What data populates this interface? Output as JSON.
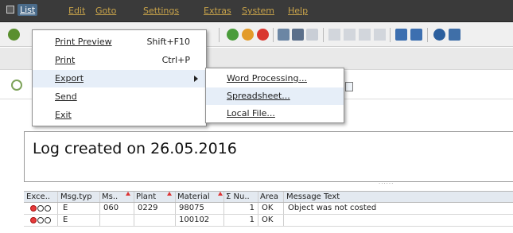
{
  "menubar": {
    "items": [
      {
        "label": "List"
      },
      {
        "label": "Edit"
      },
      {
        "label": "Goto"
      },
      {
        "label": "Settings"
      },
      {
        "label": "Extras"
      },
      {
        "label": "System"
      },
      {
        "label": "Help"
      }
    ]
  },
  "list_menu": {
    "items": [
      {
        "label": "Print Preview",
        "shortcut": "Shift+F10"
      },
      {
        "label": "Print",
        "shortcut": "Ctrl+P"
      },
      {
        "label": "Export",
        "shortcut": ""
      },
      {
        "label": "Send",
        "shortcut": ""
      },
      {
        "label": "Exit",
        "shortcut": ""
      }
    ]
  },
  "export_menu": {
    "items": [
      {
        "label": "Word Processing..."
      },
      {
        "label": "Spreadsheet..."
      },
      {
        "label": "Local File..."
      }
    ]
  },
  "log": {
    "title": "Log created on 26.05.2016",
    "grip": "......"
  },
  "grid": {
    "headers": [
      "Exce..",
      "Msg.typ",
      "Ms..",
      "Plant",
      "Material",
      "Σ Nu..",
      "Area",
      "Message Text"
    ],
    "rows": [
      {
        "exception": "error",
        "msg_type": "E",
        "msg_no": "060",
        "plant": "0229",
        "material": "98075",
        "num": "1",
        "area": "OK",
        "text": "Object was not costed"
      },
      {
        "exception": "error",
        "msg_type": "E",
        "msg_no": "",
        "plant": "",
        "material": "100102",
        "num": "1",
        "area": "OK",
        "text": ""
      }
    ]
  },
  "colors": {
    "menubar_bg": "#3a3a3a",
    "menu_text": "#c8a34a",
    "highlight": "#e6eef8"
  }
}
